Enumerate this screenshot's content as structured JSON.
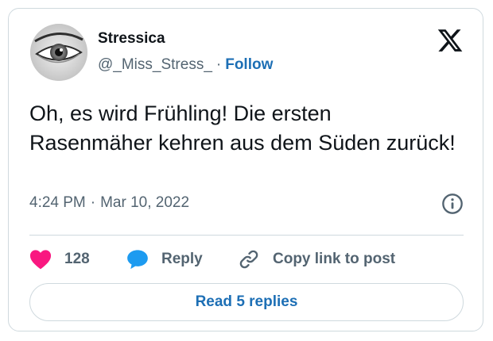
{
  "tweet": {
    "author": {
      "display_name": "Stressica",
      "handle": "@_Miss_Stress_",
      "separator": "·",
      "follow_label": "Follow",
      "avatar_icon": "eye-avatar"
    },
    "text": "Oh, es wird Frühling! Die ersten Rasenmäher kehren aus dem Süden zurück!",
    "time": "4:24 PM",
    "date_separator": "·",
    "date": "Mar 10, 2022",
    "platform_icon": "x-logo-icon",
    "info_icon": "info-icon"
  },
  "actions": {
    "like": {
      "icon": "heart-icon",
      "count": "128"
    },
    "reply": {
      "icon": "reply-bubble-icon",
      "label": "Reply"
    },
    "copy": {
      "icon": "link-icon",
      "label": "Copy link to post"
    }
  },
  "replies_button": {
    "label": "Read 5 replies"
  },
  "colors": {
    "like": "#f91880",
    "reply": "#1d9bf0",
    "follow": "#1d6fb5",
    "text": "#0f1419",
    "muted": "#536471",
    "border": "#cfd9de"
  }
}
